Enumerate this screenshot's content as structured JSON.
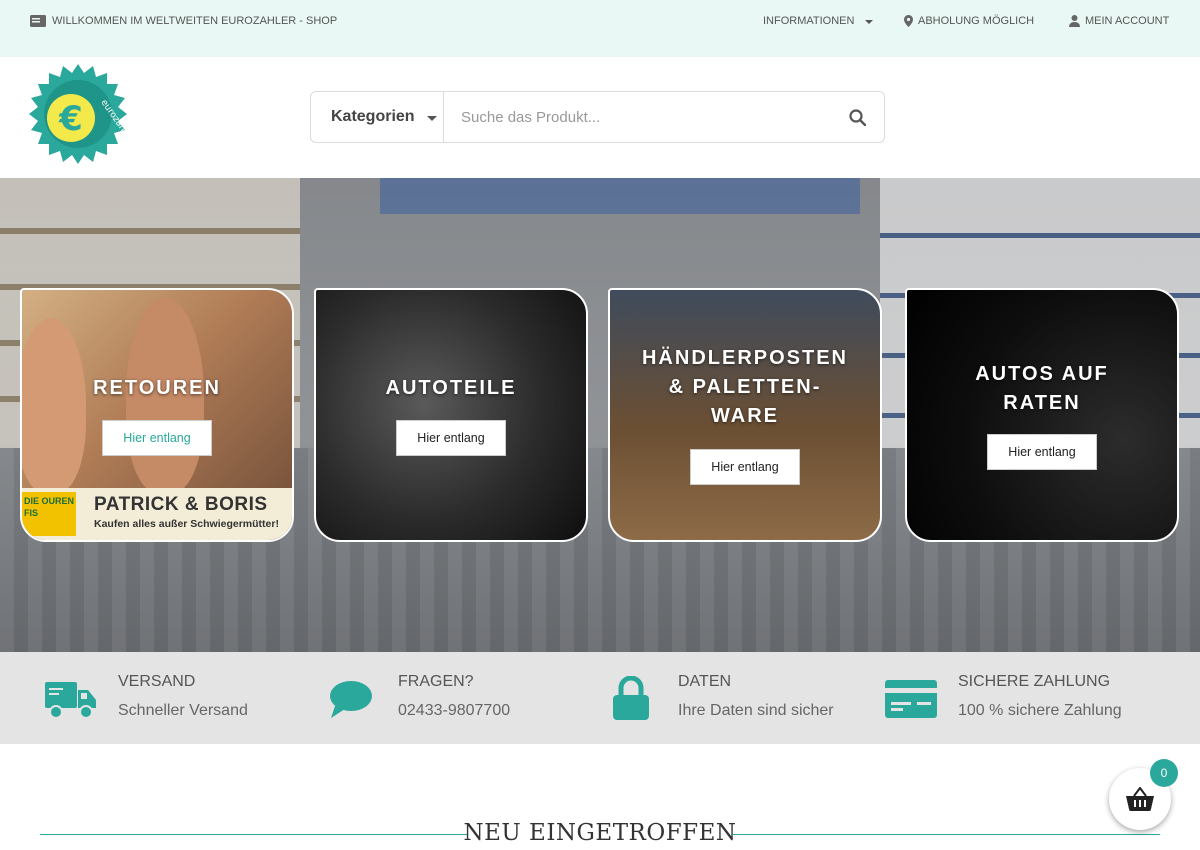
{
  "topbar": {
    "welcome": "WILLKOMMEN IM WELTWEITEN EUROZAHLER - SHOP",
    "informationen": "INFORMATIONEN",
    "abholung": "ABHOLUNG MÖGLICH",
    "account": "MEIN ACCOUNT"
  },
  "header": {
    "logo_text": "eurozahler",
    "category_label": "Kategorien",
    "search_placeholder": "Suche das Produkt..."
  },
  "hero": {
    "cards": [
      {
        "title": "RETOUREN",
        "button": "Hier entlang",
        "banner_title": "PATRICK & BORIS",
        "banner_sub": "Kaufen alles außer Schwiegermütter!",
        "banner_logo": "DIE OUREN FIS"
      },
      {
        "title": "AUTOTEILE",
        "button": "Hier entlang"
      },
      {
        "title_lines": [
          "HÄNDLERPOSTEN",
          "& PALETTEN-",
          "WARE"
        ],
        "button": "Hier entlang"
      },
      {
        "title_lines": [
          "AUTOS AUF",
          "RATEN"
        ],
        "button": "Hier entlang"
      }
    ]
  },
  "features": [
    {
      "icon": "truck-icon",
      "title": "VERSAND",
      "subtitle": "Schneller Versand"
    },
    {
      "icon": "chat-bubble-icon",
      "title": "FRAGEN?",
      "subtitle": "02433-9807700"
    },
    {
      "icon": "lock-icon",
      "title": "DATEN",
      "subtitle": "Ihre Daten sind sicher"
    },
    {
      "icon": "credit-card-icon",
      "title": "SICHERE ZAHLUNG",
      "subtitle": "100 % sichere Zahlung"
    }
  ],
  "section": {
    "title": "NEU EINGETROFFEN"
  },
  "cart": {
    "count": "0"
  },
  "colors": {
    "accent": "#2aa89b",
    "topbar_bg": "#e9f8f4",
    "features_bg": "#e4e4e5"
  }
}
